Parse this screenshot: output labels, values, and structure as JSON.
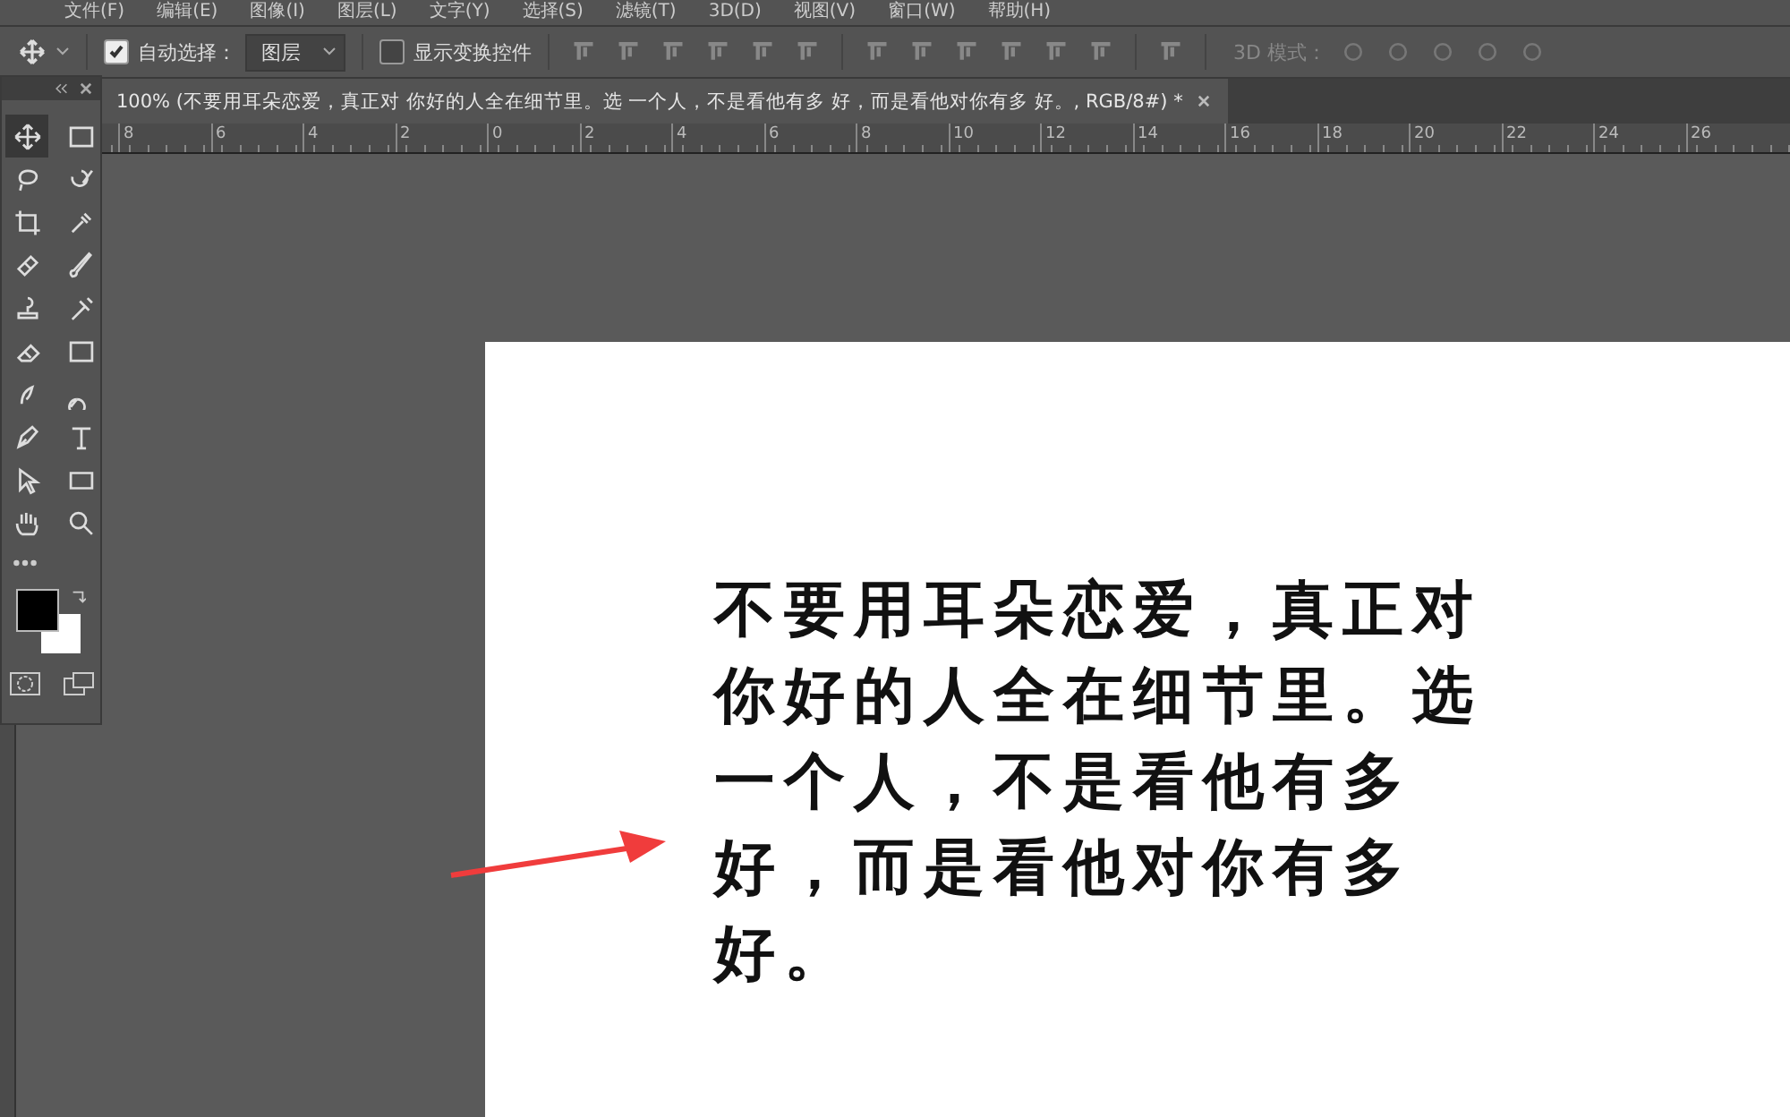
{
  "menu_bar": [
    "文件(F)",
    "编辑(E)",
    "图像(I)",
    "图层(L)",
    "文字(Y)",
    "选择(S)",
    "滤镜(T)",
    "3D(D)",
    "视图(V)",
    "窗口(W)",
    "帮助(H)"
  ],
  "options_bar": {
    "auto_select": {
      "label": "自动选择：",
      "checked": true
    },
    "target": {
      "value": "图层"
    },
    "show_transform": {
      "label": "显示变换控件",
      "checked": false
    },
    "mode_3d_label": "3D 模式："
  },
  "document_tab": {
    "title": "100% (不要用耳朵恋爱，真正对 你好的人全在细节里。选 一个人，不是看他有多 好，而是看他对你有多 好。, RGB/8#) *",
    "selected": true
  },
  "ruler": [
    "8",
    "6",
    "4",
    "2",
    "0",
    "2",
    "4",
    "6",
    "8",
    "10",
    "12",
    "14",
    "16",
    "18",
    "20",
    "22",
    "24",
    "26"
  ],
  "tools": [
    {
      "selected": true
    },
    {
      "selected": false
    },
    {
      "selected": false
    },
    {
      "selected": false
    },
    {
      "selected": false
    },
    {
      "selected": false
    },
    {
      "selected": false
    },
    {
      "selected": false
    },
    {
      "selected": false
    },
    {
      "selected": false
    },
    {
      "selected": false
    },
    {
      "selected": false
    },
    {
      "selected": false
    },
    {
      "selected": false
    },
    {
      "selected": false
    },
    {
      "selected": false
    },
    {
      "selected": false
    },
    {
      "selected": false
    },
    {
      "selected": false
    },
    {
      "selected": false
    }
  ],
  "document": {
    "lines": [
      "不要用耳朵恋爱，真正对",
      "你好的人全在细节里。选",
      "一个人，不是看他有多",
      "好，而是看他对你有多",
      "好。"
    ]
  }
}
